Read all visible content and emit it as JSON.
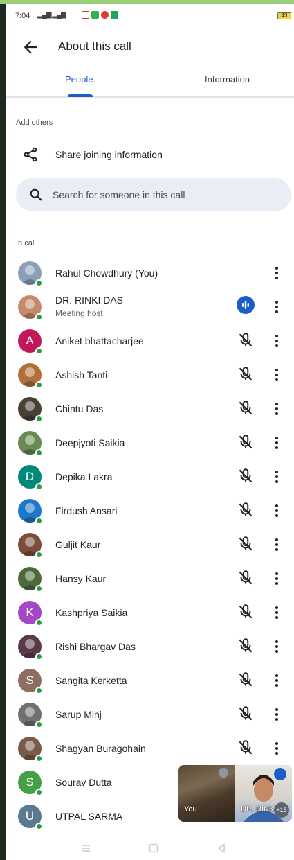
{
  "status": {
    "time": "7:04",
    "battery": "43"
  },
  "appbar": {
    "title": "About this call"
  },
  "tabs": [
    {
      "label": "People"
    },
    {
      "label": "Information"
    }
  ],
  "add_others": {
    "label": "Add others",
    "share_label": "Share joining information"
  },
  "search": {
    "placeholder": "Search for someone in this call"
  },
  "in_call": {
    "label": "In call",
    "participants": [
      {
        "name": "Rahul Chowdhury (You)",
        "avatar": "photo",
        "color": "#8aa0b8"
      },
      {
        "name": "DR. RINKI DAS",
        "role": "Meeting host",
        "avatar": "photo",
        "color": "#c58a6a",
        "speaking": true
      },
      {
        "name": "Aniket bhattacharjee",
        "avatar": "A",
        "color": "#c2185b",
        "muted": true
      },
      {
        "name": "Ashish Tanti",
        "avatar": "photo",
        "color": "#b0703a",
        "muted": true
      },
      {
        "name": "Chintu Das",
        "avatar": "photo",
        "color": "#4a4036",
        "muted": true
      },
      {
        "name": "Deepjyoti Saikia",
        "avatar": "photo",
        "color": "#6a8a55",
        "muted": true
      },
      {
        "name": "Depika Lakra",
        "avatar": "D",
        "color": "#00897b",
        "muted": true
      },
      {
        "name": "Firdush Ansari",
        "avatar": "photo",
        "color": "#1e78c8",
        "muted": true
      },
      {
        "name": "Guljit Kaur",
        "avatar": "photo",
        "color": "#7a4e3a",
        "muted": true
      },
      {
        "name": "Hansy Kaur",
        "avatar": "photo",
        "color": "#4e6a3a",
        "muted": true
      },
      {
        "name": "Kashpriya Saikia",
        "avatar": "K",
        "color": "#a347c4",
        "muted": true
      },
      {
        "name": "Rishi Bhargav Das",
        "avatar": "photo",
        "color": "#5a3a4a",
        "muted": true
      },
      {
        "name": "Sangita Kerketta",
        "avatar": "S",
        "color": "#8d6e63",
        "muted": true
      },
      {
        "name": "Sarup Minj",
        "avatar": "photo",
        "color": "#707070",
        "muted": true
      },
      {
        "name": "Shagyan Buragohain",
        "avatar": "photo",
        "color": "#7a5a48",
        "muted": true
      },
      {
        "name": "Sourav Dutta",
        "avatar": "S",
        "color": "#43a047"
      },
      {
        "name": "UTPAL SARMA",
        "avatar": "U",
        "color": "#5c7a8f"
      }
    ]
  },
  "pip": {
    "self_label": "You",
    "host_label": "DR. RINK",
    "extra_count": "+15"
  },
  "colors": {
    "accent": "#1a5fc8",
    "online": "#2e9b47"
  }
}
